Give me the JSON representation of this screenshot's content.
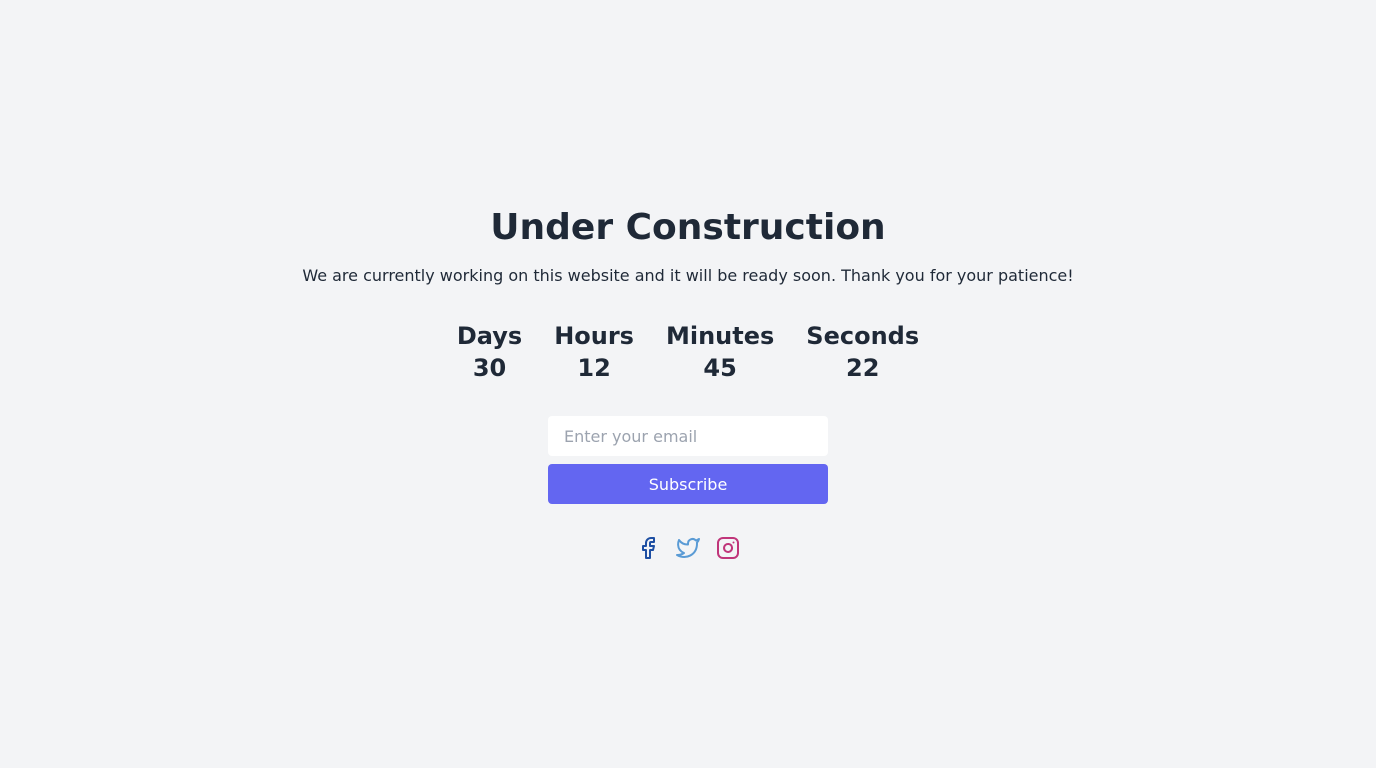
{
  "page": {
    "title": "Under Construction",
    "subtitle": "We are currently working on this website and it will be ready soon. Thank you for your patience!"
  },
  "countdown": [
    {
      "label": "Days",
      "value": "30"
    },
    {
      "label": "Hours",
      "value": "12"
    },
    {
      "label": "Minutes",
      "value": "45"
    },
    {
      "label": "Seconds",
      "value": "22"
    }
  ],
  "subscribe": {
    "email_placeholder": "Enter your email",
    "email_value": "",
    "button_label": "Subscribe"
  },
  "social": [
    {
      "name": "facebook-icon",
      "color": "#1e4fa3"
    },
    {
      "name": "twitter-icon",
      "color": "#5a9bd5"
    },
    {
      "name": "instagram-icon",
      "color": "#c0357a"
    }
  ],
  "colors": {
    "background": "#f3f4f6",
    "text": "#1f2937",
    "accent": "#6366f1",
    "placeholder": "#9ca3af"
  }
}
